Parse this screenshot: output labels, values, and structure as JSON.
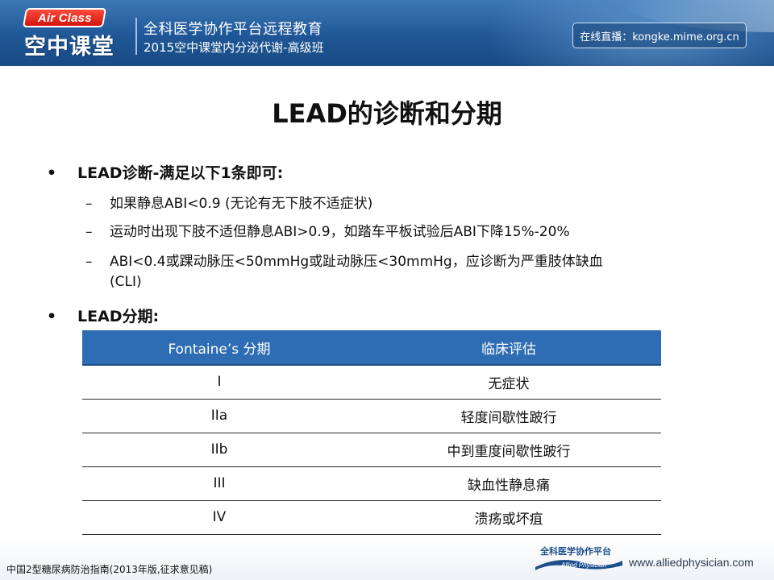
{
  "header": {
    "logo_en": "Air Class",
    "logo_cn": "空中课堂",
    "line1": "全科医学协作平台远程教育",
    "line2": "2015空中课堂内分泌代谢-高级班",
    "live": "在线直播：kongke.mime.org.cn"
  },
  "title": "LEAD的诊断和分期",
  "bullets": {
    "b1": "LEAD诊断-满足以下1条即可:",
    "b1_sub": [
      "如果静息ABI<0.9 (无论有无下肢不适症状)",
      "运动时出现下肢不适但静息ABI>0.9，如踏车平板试验后ABI下降15%-20%",
      "ABI<0.4或踝动脉压<50mmHg或趾动脉压<30mmHg，应诊断为严重肢体缺血",
      "(CLI)"
    ],
    "b2": "LEAD分期:",
    "bullet_char": "•",
    "dash_char": "–"
  },
  "table": {
    "headers": [
      "Fontaine’s 分期",
      "临床评估"
    ],
    "rows": [
      [
        "I",
        "无症状"
      ],
      [
        "IIa",
        "轻度间歇性跛行"
      ],
      [
        "IIb",
        "中到重度间歇性跛行"
      ],
      [
        "III",
        "缺血性静息痛"
      ],
      [
        "IV",
        "溃疡或坏疽"
      ]
    ]
  },
  "footer": {
    "note": "中国2型糖尿病防治指南(2013年版,征求意见稿)",
    "partner_cn": "全科医学协作平台",
    "partner_en": "Allied Physician",
    "url": "www.alliedphysician.com"
  },
  "colors": {
    "header_blue": "#1f5796",
    "table_header": "#2e6db3",
    "badge_red": "#d2140e"
  }
}
